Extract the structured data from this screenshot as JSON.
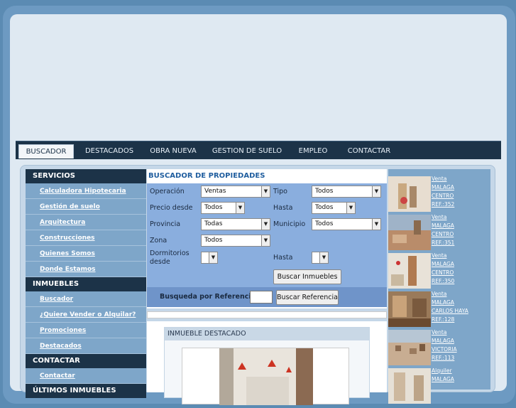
{
  "nav": {
    "tabs": [
      "BUSCADOR",
      "DESTACADOS",
      "OBRA NUEVA",
      "GESTION DE SUELO",
      "EMPLEO",
      "CONTACTAR"
    ]
  },
  "sidebar": {
    "sections": [
      {
        "title": "SERVICIOS",
        "items": [
          "Calculadora Hipotecaria",
          "Gestión de suelo",
          "Arquitectura",
          "Construcciones",
          "Quienes Somos",
          "Donde Estamos"
        ]
      },
      {
        "title": "INMUEBLES",
        "items": [
          "Buscador",
          "¿Quiere Vender o Alquilar?",
          "Promociones",
          "Destacados"
        ]
      },
      {
        "title": "CONTACTAR",
        "items": [
          "Contactar"
        ]
      },
      {
        "title": "ÚLTIMOS INMUEBLES",
        "items": []
      }
    ]
  },
  "search": {
    "title": "BUSCADOR DE PROPIEDADES",
    "operacion_label": "Operación",
    "operacion_value": "Ventas",
    "tipo_label": "Tipo",
    "tipo_value": "Todos",
    "precio_label": "Precio desde",
    "precio_value": "Todos",
    "hasta_label": "Hasta",
    "hasta_value": "Todos",
    "provincia_label": "Provincia",
    "provincia_value": "Todas",
    "municipio_label": "Municipio",
    "municipio_value": "Todos",
    "zona_label": "Zona",
    "zona_value": "Todos",
    "dormitorios_label_1": "Dormitorios",
    "dormitorios_label_2": "desde",
    "dorm_hasta_label": "Hasta",
    "buscar_button": "Buscar Inmuebles",
    "ref_label": "Busqueda por Referencia :",
    "ref_button": "Buscar Referencia"
  },
  "featured": {
    "title": "INMUEBLE DESTACADO"
  },
  "latest": [
    {
      "lines": [
        "Venta",
        "MALAGA",
        "CENTRO",
        "REF.:352"
      ]
    },
    {
      "lines": [
        "Venta",
        "MALAGA",
        "CENTRO",
        "REF.:351"
      ]
    },
    {
      "lines": [
        "Venta",
        "MALAGA",
        "CENTRO",
        "REF.:350"
      ]
    },
    {
      "lines": [
        "Venta",
        "MALAGA",
        "CARLOS HAYA",
        "REF.:128"
      ]
    },
    {
      "lines": [
        "Venta",
        "MALAGA",
        "VICTORIA",
        "REF.:113"
      ]
    },
    {
      "lines": [
        "Alquiler",
        "MALAGA"
      ]
    }
  ],
  "colors": {
    "nav_bg": "#1c3348",
    "accent": "#1f5d9e",
    "form_bg": "#8aaede"
  }
}
